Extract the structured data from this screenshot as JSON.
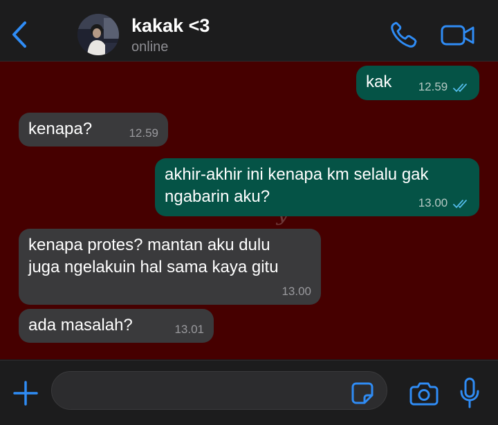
{
  "header": {
    "contact_name": "kakak <3",
    "status": "online"
  },
  "chat": {
    "watermark": "y",
    "messages": [
      {
        "direction": "outgoing",
        "text": "kak",
        "time": "12.59",
        "read": true
      },
      {
        "direction": "incoming",
        "text": "kenapa?",
        "time": "12.59"
      },
      {
        "direction": "outgoing",
        "text_lines": [
          "akhir-akhir ini kenapa km selalu gak",
          "ngabarin aku?"
        ],
        "time": "13.00",
        "read": true
      },
      {
        "direction": "incoming",
        "text_lines": [
          "kenapa protes? mantan aku dulu",
          "juga ngelakuin hal sama kaya gitu"
        ],
        "time": "13.00"
      },
      {
        "direction": "incoming",
        "text": "ada masalah?",
        "time": "13.01"
      }
    ]
  },
  "input": {
    "value": "",
    "placeholder": ""
  },
  "icons": {
    "back": "chevron-left-icon",
    "call": "phone-icon",
    "video": "video-camera-icon",
    "attach": "plus-icon",
    "sticker": "sticker-icon",
    "camera": "camera-icon",
    "mic": "microphone-icon"
  },
  "colors": {
    "accent": "#2f8cf5",
    "chat_background": "#460000",
    "outgoing_bubble": "#055346",
    "incoming_bubble": "#3a3a3c",
    "read_tick": "#53bdeb"
  }
}
